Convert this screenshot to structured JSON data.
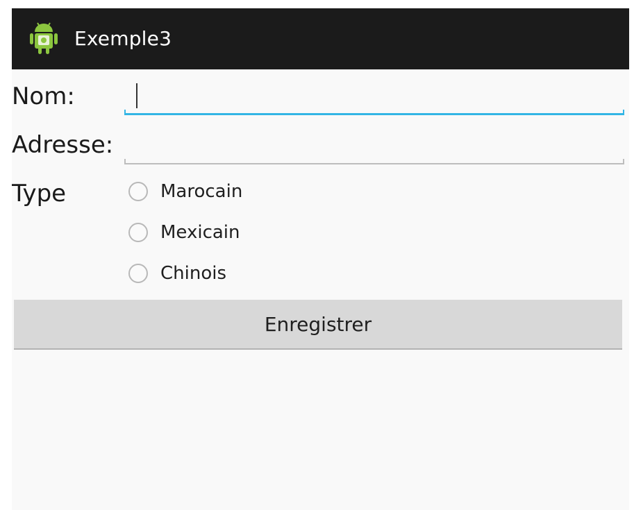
{
  "action_bar": {
    "title": "Exemple3",
    "icon": "android-robot-icon"
  },
  "form": {
    "nom_label": "Nom:",
    "nom_value": "",
    "adresse_label": "Adresse:",
    "adresse_value": "",
    "type_label": "Type",
    "type_options": [
      {
        "label": "Marocain",
        "checked": false
      },
      {
        "label": "Mexicain",
        "checked": false
      },
      {
        "label": "Chinois",
        "checked": false
      }
    ],
    "submit_label": "Enregistrer"
  },
  "colors": {
    "action_bar_bg": "#1b1b1b",
    "focus_accent": "#33b5e5",
    "app_icon_green": "#8cc63f",
    "button_bg": "#d8d8d8"
  }
}
